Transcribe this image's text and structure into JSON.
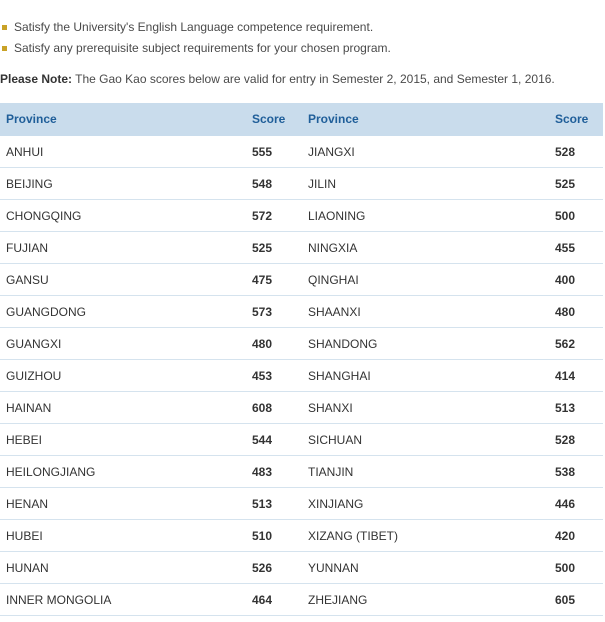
{
  "requirements": [
    "Satisfy the University's English Language competence requirement.",
    "Satisfy any prerequisite subject requirements for your chosen program."
  ],
  "note": {
    "label": "Please Note:",
    "text": " The Gao Kao scores below are valid for entry in Semester 2, 2015, and Semester 1, 2016."
  },
  "table": {
    "headers": [
      "Province",
      "Score",
      "Province",
      "Score"
    ],
    "rows": [
      [
        "ANHUI",
        "555",
        "JIANGXI",
        "528"
      ],
      [
        "BEIJING",
        "548",
        "JILIN",
        "525"
      ],
      [
        "CHONGQING",
        "572",
        "LIAONING",
        "500"
      ],
      [
        "FUJIAN",
        "525",
        "NINGXIA",
        "455"
      ],
      [
        "GANSU",
        "475",
        "QINGHAI",
        "400"
      ],
      [
        "GUANGDONG",
        "573",
        "SHAANXI",
        "480"
      ],
      [
        "GUANGXI",
        "480",
        "SHANDONG",
        "562"
      ],
      [
        "GUIZHOU",
        "453",
        "SHANGHAI",
        "414"
      ],
      [
        "HAINAN",
        "608",
        "SHANXI",
        "513"
      ],
      [
        "HEBEI",
        "544",
        "SICHUAN",
        "528"
      ],
      [
        "HEILONGJIANG",
        "483",
        "TIANJIN",
        "538"
      ],
      [
        "HENAN",
        "513",
        "XINJIANG",
        "446"
      ],
      [
        "HUBEI",
        "510",
        "XIZANG (TIBET)",
        "420"
      ],
      [
        "HUNAN",
        "526",
        "YUNNAN",
        "500"
      ],
      [
        "INNER MONGOLIA",
        "464",
        "ZHEJIANG",
        "605"
      ]
    ]
  },
  "colors": {
    "bullet": "#c9a227",
    "header_bg": "#c9dcec",
    "header_text": "#1f5e99",
    "row_divider": "#d5e3ee"
  }
}
